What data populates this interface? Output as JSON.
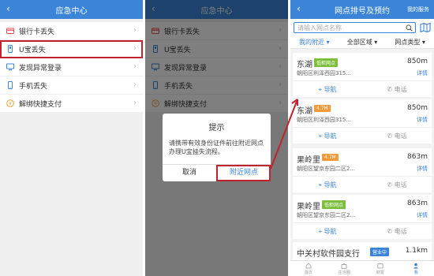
{
  "screen1": {
    "title": "应急中心",
    "items": [
      "银行卡丢失",
      "U宝丢失",
      "发现异常登录",
      "手机丢失",
      "解绑快捷支付"
    ]
  },
  "screen2": {
    "title": "应急中心",
    "items": [
      "银行卡丢失",
      "U宝丢失",
      "发现异常登录",
      "手机丢失",
      "解绑快捷支付"
    ],
    "dialog": {
      "title": "提示",
      "message": "请携带有效身份证件前往附近网点办理U宝挂失流程。",
      "cancel": "取消",
      "confirm": "附近网点"
    }
  },
  "screen3": {
    "title": "网点排号及预约",
    "my_service": "我的服务",
    "search_placeholder": "请输入网点名称",
    "tabs": [
      "我的附近",
      "全部区域",
      "网点类型"
    ],
    "branches": [
      {
        "name": "东湖",
        "tag": "低柜网点",
        "tag_color": "#7cbf3a",
        "distance": "850m",
        "address": "朝阳区利泽西园315...",
        "detail": "详情",
        "nav": "导航",
        "tel": "电话"
      },
      {
        "name": "东湖",
        "tag": "4.7M",
        "tag_color": "#f09a3a",
        "distance": "850m",
        "address": "朝阳区利泽西园315...",
        "detail": "详情",
        "nav": "导航",
        "tel": "电话"
      },
      {
        "name": "果岭里",
        "tag": "4.7M",
        "tag_color": "#f09a3a",
        "distance": "863m",
        "address": "朝阳区望京东园二区2...",
        "detail": "详情",
        "nav": "导航",
        "tel": "电话"
      },
      {
        "name": "果岭里",
        "tag": "低柜网点",
        "tag_color": "#7cbf3a",
        "distance": "863m",
        "address": "朝阳区望京东园二区2...",
        "detail": "详情",
        "nav": "导航",
        "tel": "电话"
      }
    ],
    "partial_branch": {
      "name": "中关村软件园支行",
      "tag": "营业中",
      "distance": "1.1km"
    },
    "bottom_nav": [
      "首页",
      "生活圈",
      "财富",
      "我"
    ]
  },
  "colors": {
    "primary": "#3b84d8",
    "highlight": "#c0222e"
  }
}
